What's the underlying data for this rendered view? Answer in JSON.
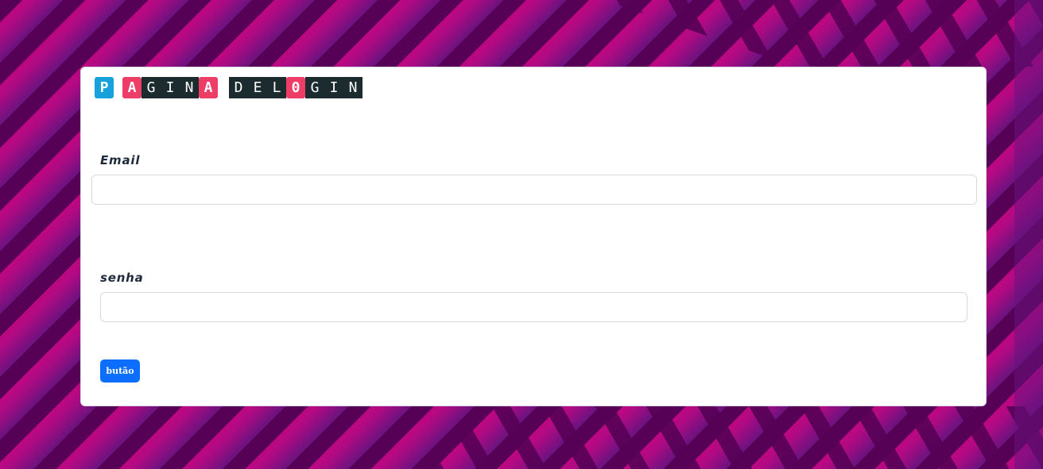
{
  "page": {
    "title_tiles": [
      {
        "char": "P",
        "style": "blue"
      },
      {
        "char": "A",
        "style": "red"
      },
      {
        "char": "G",
        "style": "dark"
      },
      {
        "char": "I",
        "style": "dark"
      },
      {
        "char": "N",
        "style": "dark"
      },
      {
        "char": "A",
        "style": "red"
      },
      {
        "char": "",
        "style": "gap"
      },
      {
        "char": "D",
        "style": "dark"
      },
      {
        "char": "E",
        "style": "dark"
      },
      {
        "char": "L",
        "style": "dark"
      },
      {
        "char": "0",
        "style": "red"
      },
      {
        "char": "G",
        "style": "dark"
      },
      {
        "char": "I",
        "style": "dark"
      },
      {
        "char": "N",
        "style": "dark"
      }
    ]
  },
  "form": {
    "email_label": "Email",
    "email_value": "",
    "password_label": "senha",
    "password_value": "",
    "submit_label": "butão"
  },
  "colors": {
    "background_magenta": "#d6007f",
    "background_dark": "#560056",
    "background_purple": "#6a137f",
    "button_blue": "#0d6efd",
    "tile_blue": "#17a2dc",
    "tile_red": "#ee3d67",
    "tile_dark": "#1b2b2e"
  }
}
